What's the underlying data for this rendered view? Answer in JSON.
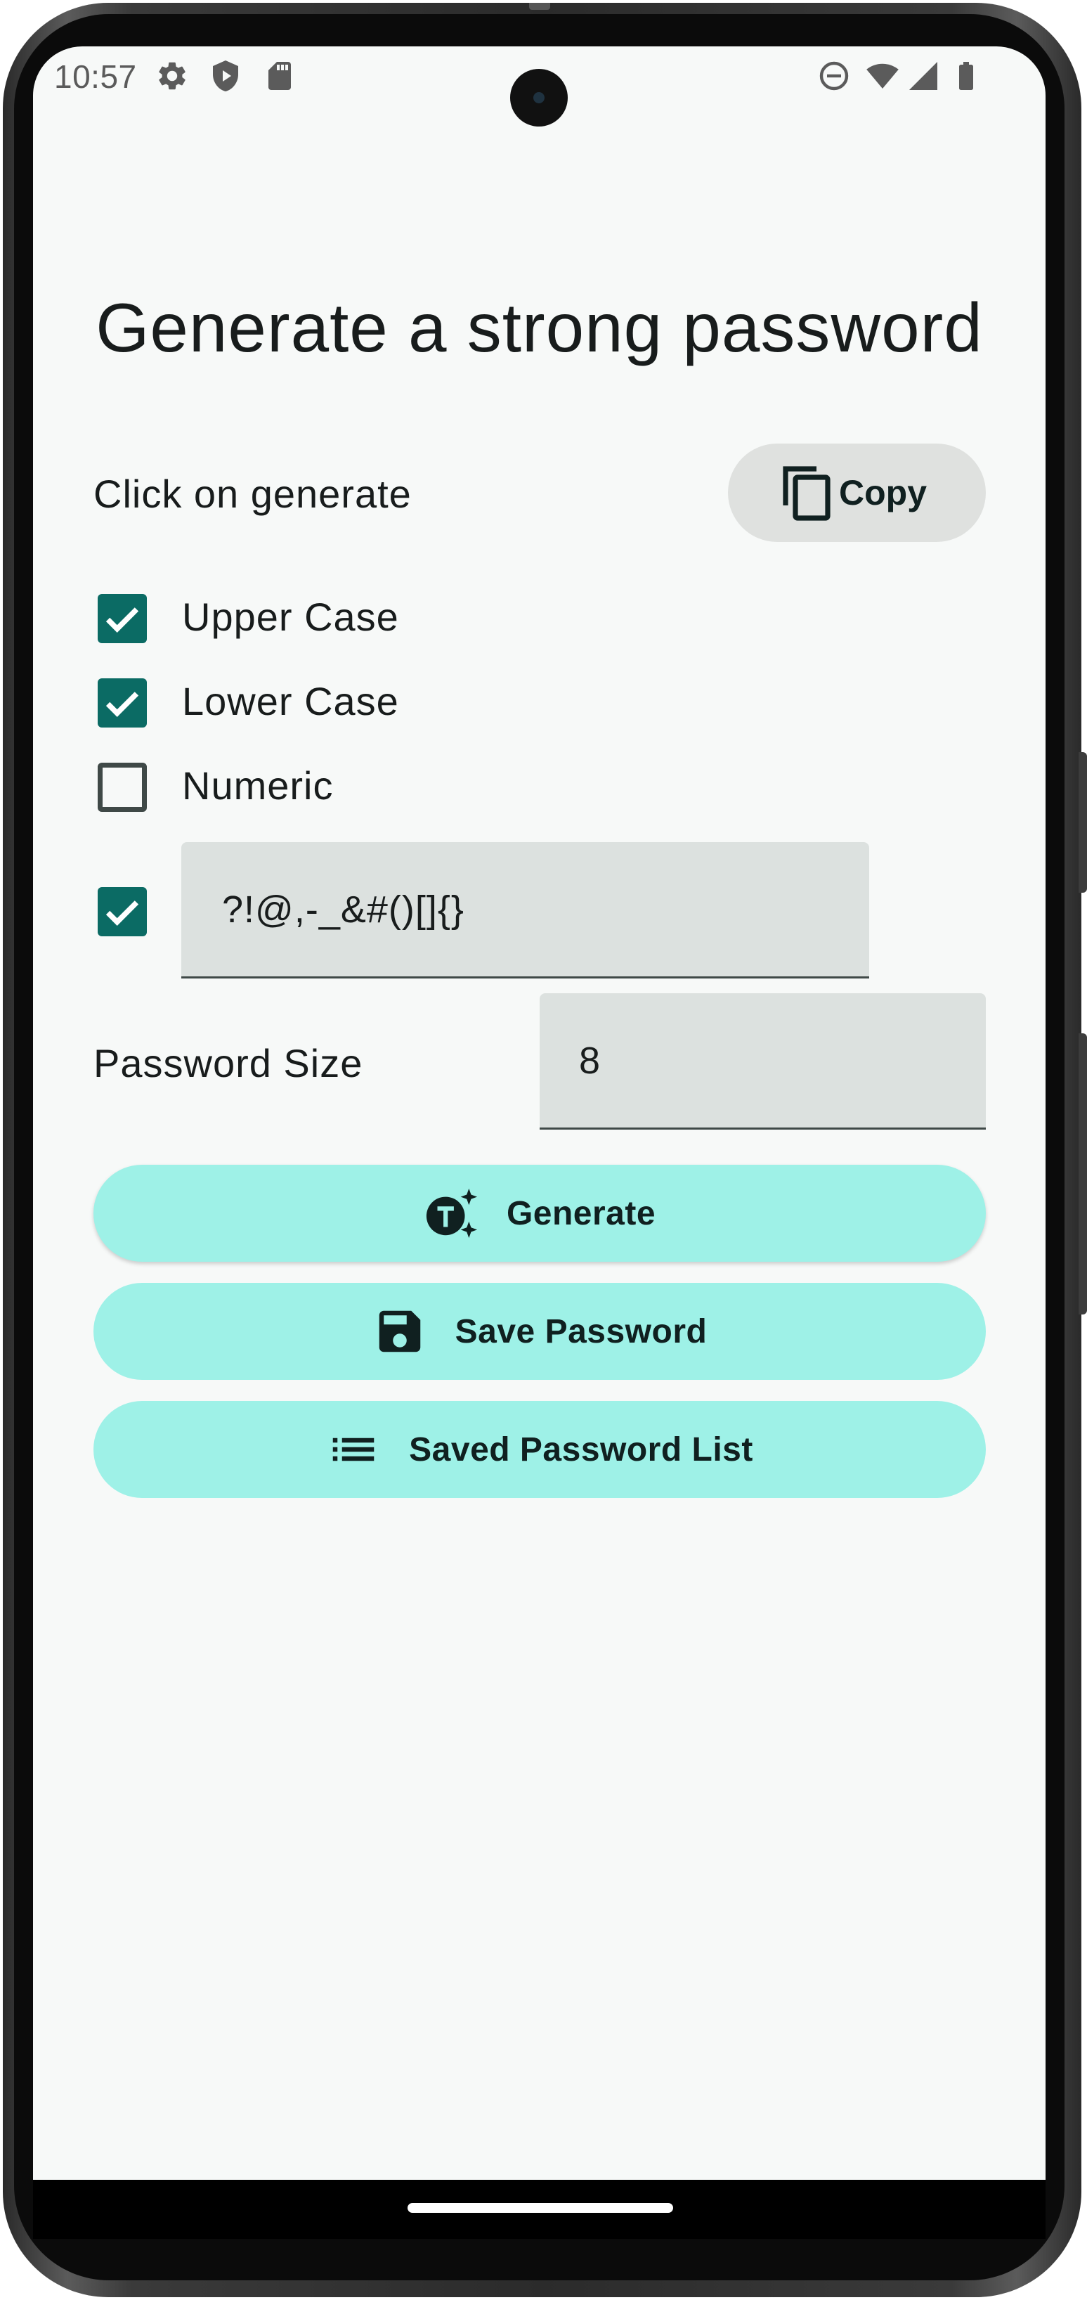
{
  "status_bar": {
    "time": "10:57",
    "left_icons": [
      "gear-icon",
      "shield-play-icon",
      "sd-card-icon"
    ],
    "right_icons": [
      "do-not-disturb-icon",
      "wifi-icon",
      "signal-icon",
      "battery-icon"
    ]
  },
  "screen": {
    "title": "Generate a strong password",
    "result_text": "Click on generate",
    "copy_button": {
      "label": "Copy",
      "icon": "copy-icon"
    },
    "options": [
      {
        "label": "Upper Case",
        "checked": true
      },
      {
        "label": "Lower Case",
        "checked": true
      },
      {
        "label": "Numeric",
        "checked": false
      }
    ],
    "special_chars": {
      "checked": true,
      "value": "?!@,-_&#()[]{}"
    },
    "password_size": {
      "label": "Password Size",
      "value": "8"
    },
    "buttons": {
      "generate": {
        "label": "Generate",
        "icon": "auto-awesome-icon"
      },
      "save": {
        "label": "Save Password",
        "icon": "save-icon"
      },
      "list": {
        "label": "Saved Password List",
        "icon": "list-icon"
      }
    }
  },
  "colors": {
    "accent": "#0b6b64",
    "button_bg": "#9ef1e7",
    "copy_bg": "#dfe1df",
    "field_bg": "#dce1df",
    "screen_bg": "#f7f9f8"
  }
}
